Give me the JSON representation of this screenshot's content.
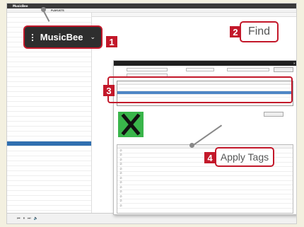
{
  "app": {
    "title": "MusicBee",
    "nav_tabs": [
      "",
      "",
      "",
      "PLAYLISTS",
      "",
      "",
      ""
    ]
  },
  "left_panel": {
    "rows": [
      {
        "num": "",
        "name": ""
      },
      {
        "num": "",
        "name": ""
      },
      {
        "num": "",
        "name": ""
      },
      {
        "num": "",
        "name": ""
      },
      {
        "num": "",
        "name": ""
      },
      {
        "num": "",
        "name": ""
      },
      {
        "num": "",
        "name": ""
      },
      {
        "num": "",
        "name": ""
      },
      {
        "num": "",
        "name": ""
      },
      {
        "num": "",
        "name": ""
      },
      {
        "num": "",
        "name": ""
      },
      {
        "num": "",
        "name": ""
      },
      {
        "num": "",
        "name": ""
      },
      {
        "num": "",
        "name": ""
      },
      {
        "num": "",
        "name": ""
      },
      {
        "num": "",
        "name": ""
      },
      {
        "num": "",
        "name": ""
      },
      {
        "num": "",
        "name": ""
      },
      {
        "num": "",
        "name": ""
      },
      {
        "num": "",
        "name": ""
      },
      {
        "num": "",
        "name": ""
      },
      {
        "num": "",
        "name": ""
      },
      {
        "num": "",
        "name": ""
      },
      {
        "num": "",
        "name": ""
      },
      {
        "num": "",
        "name": ""
      },
      {
        "num": "",
        "name": ""
      },
      {
        "num": "",
        "name": ""
      },
      {
        "num": "",
        "name": ""
      },
      {
        "num": "",
        "name": ""
      },
      {
        "num": "",
        "name": ""
      },
      {
        "num": "",
        "name": ""
      },
      {
        "num": "",
        "name": ""
      },
      {
        "num": "",
        "name": ""
      },
      {
        "num": "",
        "name": ""
      },
      {
        "num": "",
        "name": ""
      },
      {
        "num": "",
        "name": ""
      },
      {
        "num": "",
        "name": ""
      },
      {
        "num": "",
        "name": ""
      },
      {
        "num": "",
        "name": ""
      },
      {
        "num": "",
        "name": ""
      }
    ]
  },
  "main": {
    "columns": [
      "",
      "",
      "",
      "",
      ""
    ]
  },
  "dialog": {
    "title": "",
    "fields": {
      "artist": "",
      "album": ""
    },
    "search_button": "",
    "results_header": [
      "",
      "",
      "",
      "",
      ""
    ],
    "results": [
      {
        "a": "",
        "b": "",
        "c": "",
        "d": "",
        "e": "",
        "sel": false
      },
      {
        "a": "",
        "b": "",
        "c": "",
        "d": "",
        "e": "",
        "sel": false
      },
      {
        "a": "",
        "b": "",
        "c": "",
        "d": "",
        "e": "",
        "sel": true
      },
      {
        "a": "",
        "b": "",
        "c": "",
        "d": "",
        "e": "",
        "sel": false
      }
    ],
    "tag_rows": [
      {
        "t1": "",
        "t2": "",
        "t3": "",
        "t4": "",
        "t5": "",
        "t6": ""
      },
      {
        "t1": "",
        "t2": "",
        "t3": "",
        "t4": "",
        "t5": "",
        "t6": ""
      },
      {
        "t1": "",
        "t2": "",
        "t3": "",
        "t4": "",
        "t5": "",
        "t6": ""
      },
      {
        "t1": "",
        "t2": "",
        "t3": "",
        "t4": "",
        "t5": "",
        "t6": ""
      },
      {
        "t1": "",
        "t2": "",
        "t3": "",
        "t4": "",
        "t5": "",
        "t6": ""
      },
      {
        "t1": "",
        "t2": "",
        "t3": "",
        "t4": "",
        "t5": "",
        "t6": ""
      },
      {
        "t1": "",
        "t2": "",
        "t3": "",
        "t4": "",
        "t5": "",
        "t6": ""
      },
      {
        "t1": "",
        "t2": "",
        "t3": "",
        "t4": "",
        "t5": "",
        "t6": ""
      },
      {
        "t1": "",
        "t2": "",
        "t3": "",
        "t4": "",
        "t5": "",
        "t6": ""
      },
      {
        "t1": "",
        "t2": "",
        "t3": "",
        "t4": "",
        "t5": "",
        "t6": ""
      },
      {
        "t1": "",
        "t2": "",
        "t3": "",
        "t4": "",
        "t5": "",
        "t6": ""
      },
      {
        "t1": "",
        "t2": "",
        "t3": "",
        "t4": "",
        "t5": "",
        "t6": ""
      },
      {
        "t1": "",
        "t2": "",
        "t3": "",
        "t4": "",
        "t5": "",
        "t6": ""
      }
    ]
  },
  "callouts": {
    "badge1": "1",
    "badge2": "2",
    "badge3": "3",
    "badge4": "4",
    "musicbee": "MusicBee",
    "find": "Find",
    "apply_tags": "Apply Tags"
  },
  "colors": {
    "accent_red": "#c3182a",
    "album_green": "#39b54a"
  },
  "icons": {
    "menu": "hamburger-menu-icon",
    "chevron": "chevron-down-icon"
  }
}
